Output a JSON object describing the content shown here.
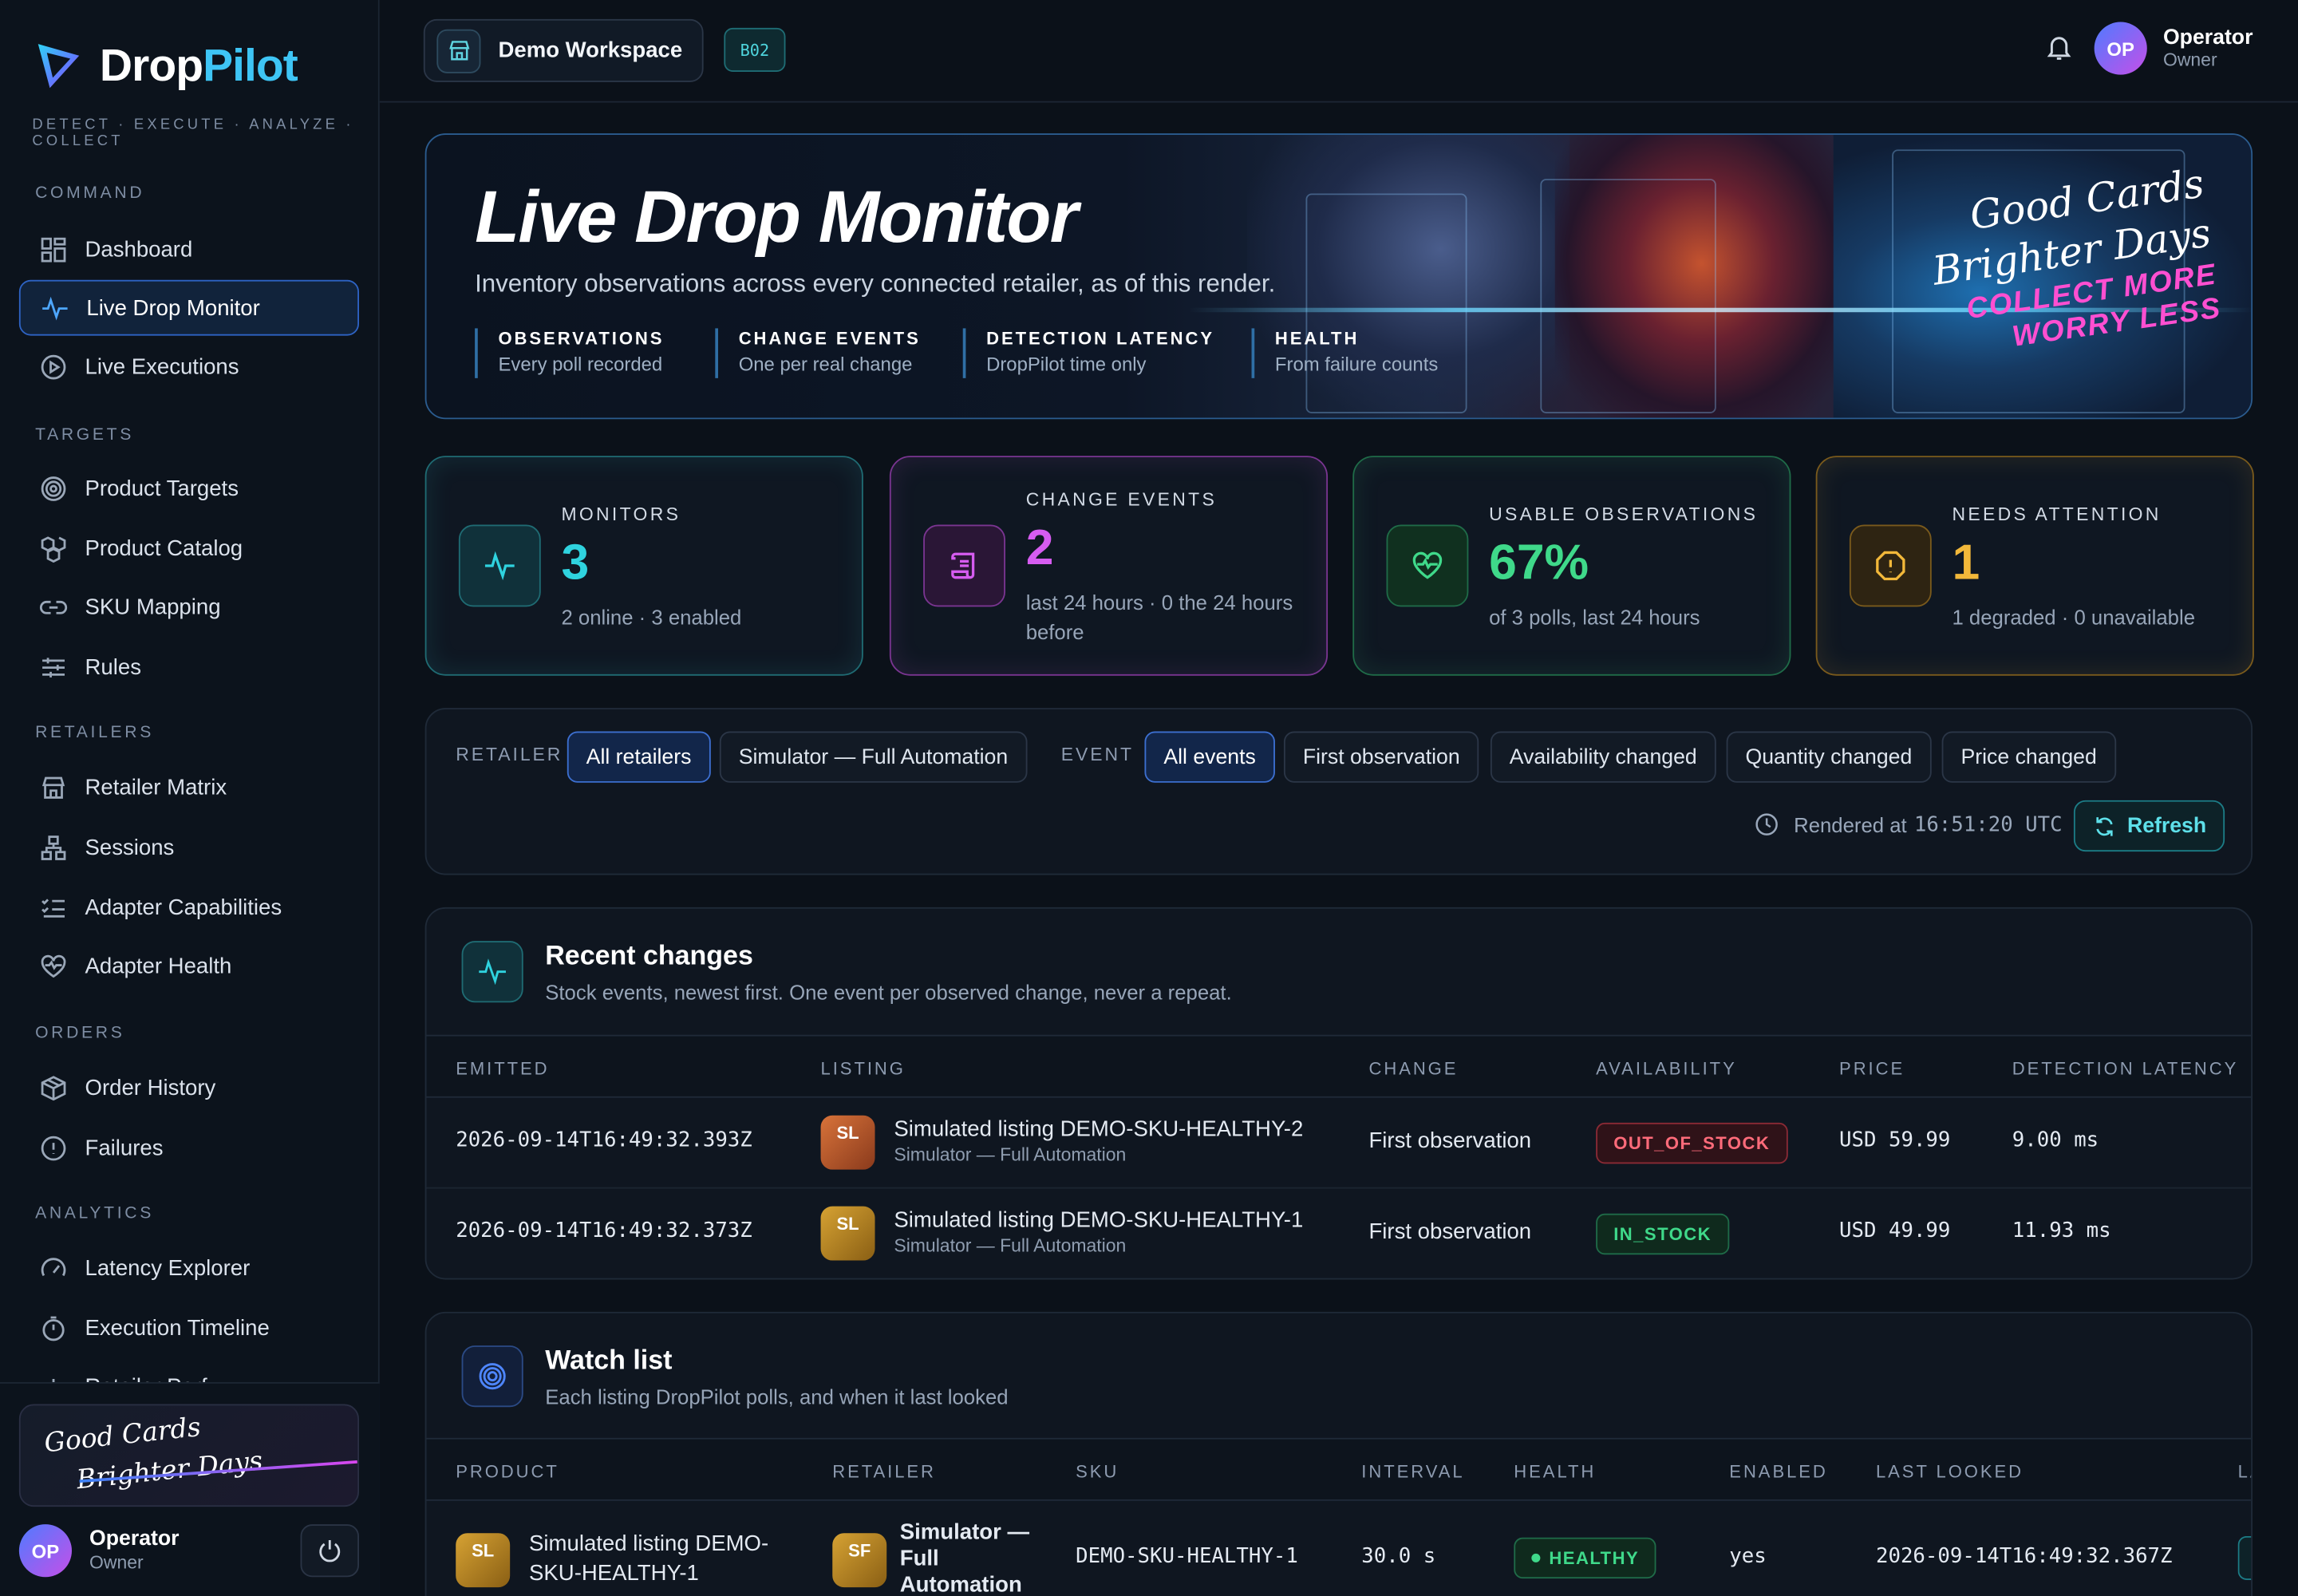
{
  "brand": {
    "name_a": "Drop",
    "name_b": "Pilot",
    "tagline": "DETECT · EXECUTE · ANALYZE · COLLECT"
  },
  "sidebar": {
    "sections": [
      {
        "label": "COMMAND",
        "items": [
          {
            "label": "Dashboard",
            "icon": "grid-icon"
          },
          {
            "label": "Live Drop Monitor",
            "icon": "pulse-icon",
            "active": true
          },
          {
            "label": "Live Executions",
            "icon": "play-circle-icon"
          }
        ]
      },
      {
        "label": "TARGETS",
        "items": [
          {
            "label": "Product Targets",
            "icon": "target-icon"
          },
          {
            "label": "Product Catalog",
            "icon": "boxes-icon"
          },
          {
            "label": "SKU Mapping",
            "icon": "link-icon"
          },
          {
            "label": "Rules",
            "icon": "sliders-icon"
          }
        ]
      },
      {
        "label": "RETAILERS",
        "items": [
          {
            "label": "Retailer Matrix",
            "icon": "store-icon"
          },
          {
            "label": "Sessions",
            "icon": "network-icon"
          },
          {
            "label": "Adapter Capabilities",
            "icon": "checklist-icon"
          },
          {
            "label": "Adapter Health",
            "icon": "heart-pulse-icon"
          }
        ]
      },
      {
        "label": "ORDERS",
        "items": [
          {
            "label": "Order History",
            "icon": "package-icon"
          },
          {
            "label": "Failures",
            "icon": "alert-circle-icon"
          }
        ]
      },
      {
        "label": "ANALYTICS",
        "items": [
          {
            "label": "Latency Explorer",
            "icon": "gauge-icon"
          },
          {
            "label": "Execution Timeline",
            "icon": "timer-icon"
          },
          {
            "label": "Retailer Perf",
            "icon": "bar-chart-icon"
          }
        ]
      }
    ],
    "promo": {
      "line1": "Good Cards",
      "line2": "Brighter Days"
    },
    "user": {
      "initials": "OP",
      "name": "Operator",
      "role": "Owner"
    }
  },
  "topbar": {
    "workspace": "Demo Workspace",
    "workspace_code": "B02",
    "user": {
      "initials": "OP",
      "name": "Operator",
      "role": "Owner"
    }
  },
  "hero": {
    "title": "Live Drop Monitor",
    "subtitle": "Inventory observations across every connected retailer, as of this render.",
    "pills": [
      {
        "k": "OBSERVATIONS",
        "v": "Every poll recorded"
      },
      {
        "k": "CHANGE EVENTS",
        "v": "One per real change"
      },
      {
        "k": "DETECTION LATENCY",
        "v": "DropPilot time only"
      },
      {
        "k": "HEALTH",
        "v": "From failure counts"
      }
    ],
    "slogan": {
      "l1": "Good Cards",
      "l2": "Brighter Days",
      "l3": "COLLECT MORE",
      "l4": "WORRY LESS"
    }
  },
  "stats": [
    {
      "label": "MONITORS",
      "value": "3",
      "note": "2 online · 3 enabled",
      "color": "#2fd3df",
      "icon": "pulse-icon"
    },
    {
      "label": "CHANGE EVENTS",
      "value": "2",
      "note": "last 24 hours · 0 the 24 hours before",
      "color": "#d65cf0",
      "icon": "scroll-icon"
    },
    {
      "label": "USABLE OBSERVATIONS",
      "value": "67%",
      "note": "of 3 polls, last 24 hours",
      "color": "#3fd98a",
      "icon": "heart-pulse-icon"
    },
    {
      "label": "NEEDS ATTENTION",
      "value": "1",
      "note": "1 degraded · 0 unavailable",
      "color": "#f2b83a",
      "icon": "alert-octagon-icon"
    }
  ],
  "filters": {
    "retailer_label": "RETAILER",
    "retailer_options": [
      "All retailers",
      "Simulator — Full Automation"
    ],
    "event_label": "EVENT",
    "event_options": [
      "All events",
      "First observation",
      "Availability changed",
      "Quantity changed",
      "Price changed"
    ],
    "rendered_label": "Rendered at",
    "rendered_time": "16:51:20 UTC",
    "refresh_label": "Refresh"
  },
  "recent": {
    "title": "Recent changes",
    "subtitle": "Stock events, newest first. One event per observed change, never a repeat.",
    "columns": [
      "EMITTED",
      "LISTING",
      "CHANGE",
      "AVAILABILITY",
      "PRICE",
      "DETECTION LATENCY"
    ],
    "rows": [
      {
        "emitted": "2026-09-14T16:49:32.393Z",
        "thumb": "SL",
        "listing": "Simulated listing DEMO-SKU-HEALTHY-2",
        "retailer": "Simulator — Full Automation",
        "change": "First observation",
        "availability": "OUT_OF_STOCK",
        "price": "USD 59.99",
        "latency": "9.00 ms"
      },
      {
        "emitted": "2026-09-14T16:49:32.373Z",
        "thumb": "SL",
        "listing": "Simulated listing DEMO-SKU-HEALTHY-1",
        "retailer": "Simulator — Full Automation",
        "change": "First observation",
        "availability": "IN_STOCK",
        "price": "USD 49.99",
        "latency": "11.93 ms"
      }
    ]
  },
  "watch": {
    "title": "Watch list",
    "subtitle": "Each listing DropPilot polls, and when it last looked",
    "columns": [
      "PRODUCT",
      "RETAILER",
      "SKU",
      "INTERVAL",
      "HEALTH",
      "ENABLED",
      "LAST LOOKED",
      "LA"
    ],
    "rows": [
      {
        "thumb": "SL",
        "product": "Simulated listing DEMO-SKU-HEALTHY-1",
        "retailer_thumb": "SF",
        "retailer": "Simulator — Full Automation",
        "sku": "DEMO-SKU-HEALTHY-1",
        "interval": "30.0 s",
        "health": "HEALTHY",
        "enabled": "yes",
        "last_looked": "2026-09-14T16:49:32.367Z"
      }
    ]
  }
}
